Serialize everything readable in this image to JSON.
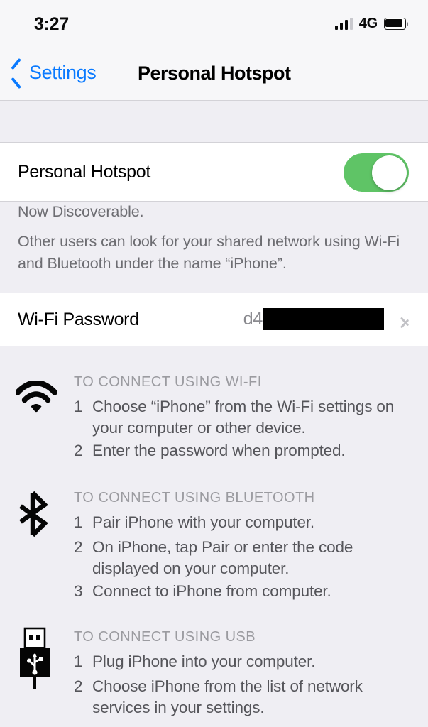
{
  "status_bar": {
    "time": "3:27",
    "network_type": "4G",
    "signal_icon": "cellular-bars-icon",
    "battery_icon": "battery-full-icon",
    "signal_bars_filled": 3,
    "signal_bars_total": 4
  },
  "nav": {
    "back_label": "Settings",
    "back_icon": "chevron-left-icon",
    "title": "Personal Hotspot"
  },
  "hotspot_row": {
    "label": "Personal Hotspot",
    "toggle_state": "on",
    "toggle_color": "#5FC466"
  },
  "discoverable_note": {
    "line1": "Now Discoverable.",
    "line2": "Other users can look for your shared network using Wi-Fi and Bluetooth under the name “iPhone”."
  },
  "password_row": {
    "label": "Wi-Fi Password",
    "value_prefix": "d4",
    "value_redacted": true,
    "disclosure_icon": "chevron-right-icon"
  },
  "instructions": [
    {
      "icon": "wifi-icon",
      "heading": "TO CONNECT USING WI-FI",
      "steps": [
        {
          "num": "1",
          "text": "Choose “iPhone” from the Wi-Fi settings on your computer or other device."
        },
        {
          "num": "2",
          "text": "Enter the password when prompted."
        }
      ]
    },
    {
      "icon": "bluetooth-icon",
      "heading": "TO CONNECT USING BLUETOOTH",
      "steps": [
        {
          "num": "1",
          "text": "Pair iPhone with your computer."
        },
        {
          "num": "2",
          "text": "On iPhone, tap Pair or enter the code displayed on your computer."
        },
        {
          "num": "3",
          "text": "Connect to iPhone from computer."
        }
      ]
    },
    {
      "icon": "usb-icon",
      "heading": "TO CONNECT USING USB",
      "steps": [
        {
          "num": "1",
          "text": "Plug iPhone into your computer."
        },
        {
          "num": "2",
          "text": "Choose iPhone from the list of network services in your settings."
        }
      ]
    }
  ]
}
